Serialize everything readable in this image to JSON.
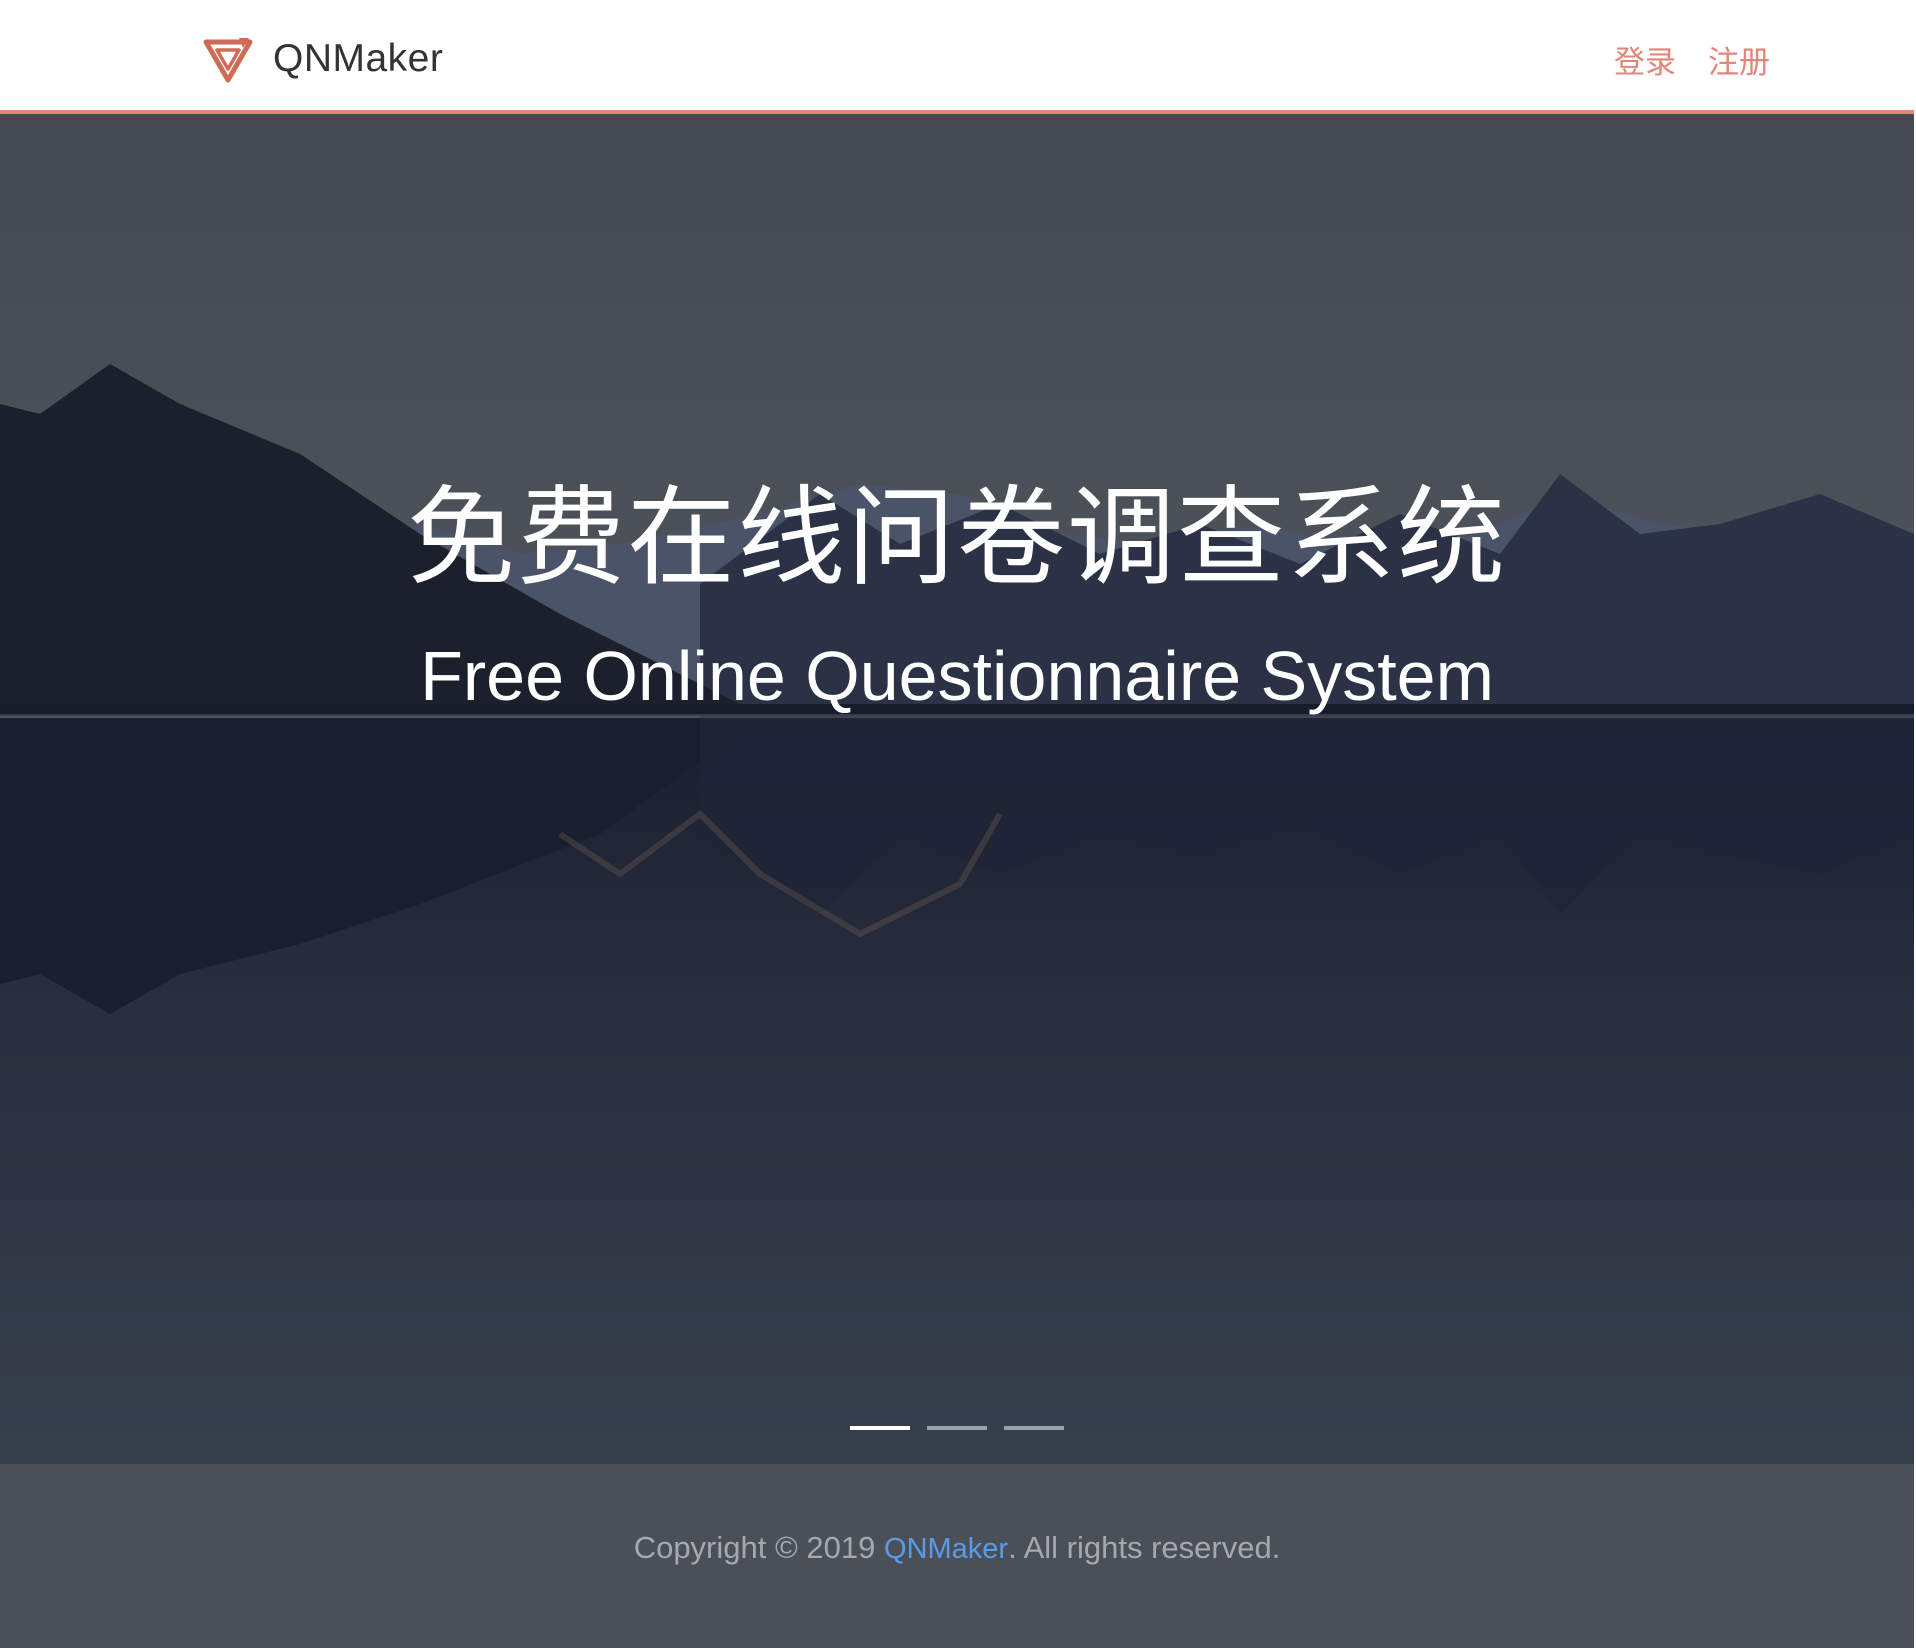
{
  "navbar": {
    "brand_name": "QNMaker",
    "login_label": "登录",
    "register_label": "注册",
    "accent_color": "#e2867a"
  },
  "hero": {
    "title_cn": "免费在线问卷调查系统",
    "title_en": "Free Online Questionnaire System",
    "carousel": {
      "slide_count": 3,
      "active_index": 0
    }
  },
  "footer": {
    "prefix": "Copyright © 2019 ",
    "brand_link": "QNMaker",
    "suffix": ". All rights reserved.",
    "link_color": "#5b9be6"
  },
  "icons": {
    "brand_logo": "qnmaker-logo-icon"
  }
}
